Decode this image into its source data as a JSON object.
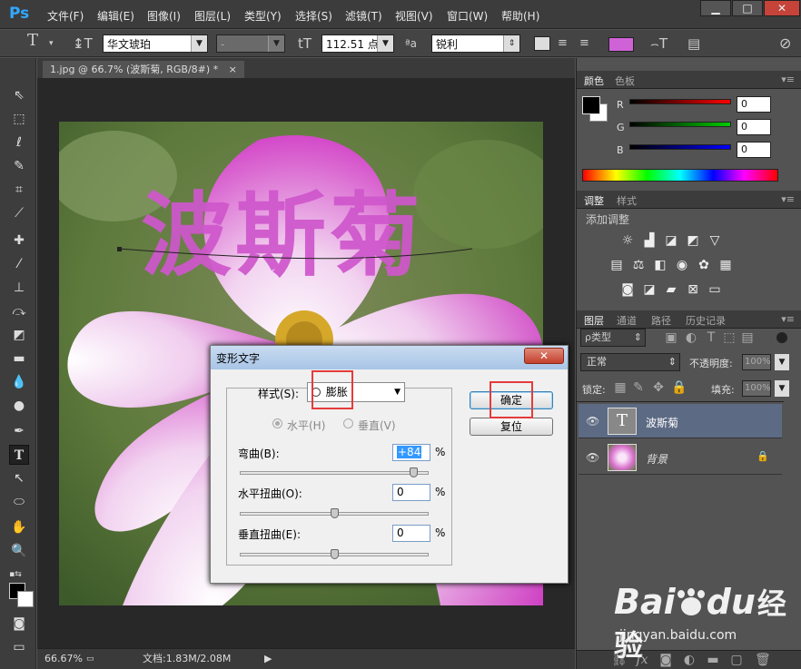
{
  "menubar": {
    "logo": "Ps",
    "items": [
      "文件(F)",
      "编辑(E)",
      "图像(I)",
      "图层(L)",
      "类型(Y)",
      "选择(S)",
      "滤镜(T)",
      "视图(V)",
      "窗口(W)",
      "帮助(H)"
    ]
  },
  "window_controls": {
    "minimize": "▁",
    "maximize": "□",
    "close": "✕"
  },
  "options_bar": {
    "font_family": "华文琥珀",
    "font_style": "-",
    "font_size": "112.51 点",
    "aa_label": "ªa",
    "antialias": "锐利",
    "text_color": "#d062d8"
  },
  "document": {
    "tab_title": "1.jpg @ 66.7% (波斯菊, RGB/8#) *",
    "tab_close": "×",
    "warped_text": "波斯菊",
    "text_color": "#cf57cc"
  },
  "statusbar": {
    "zoom": "66.67%",
    "doc_info": "文档:1.83M/2.08M"
  },
  "color_panel": {
    "tabs": [
      "颜色",
      "色板"
    ],
    "channels": [
      {
        "label": "R",
        "value": "0"
      },
      {
        "label": "G",
        "value": "0"
      },
      {
        "label": "B",
        "value": "0"
      }
    ]
  },
  "adjust_panel": {
    "tabs": [
      "调整",
      "样式"
    ],
    "title": "添加调整"
  },
  "layers_panel": {
    "tabs": [
      "图层",
      "通道",
      "路径",
      "历史记录"
    ],
    "filter_label": "ρ类型",
    "blend_mode": "正常",
    "opacity_label": "不透明度:",
    "opacity_value": "100%",
    "lock_label": "锁定:",
    "fill_label": "填充:",
    "fill_value": "100%",
    "layers": [
      {
        "name": "波斯菊",
        "thumb": "T",
        "selected": true
      },
      {
        "name": "背景",
        "thumb": "",
        "selected": false
      }
    ]
  },
  "dialog": {
    "title": "变形文字",
    "close": "✕",
    "style_label": "样式(S):",
    "style_value": "膨胀",
    "horizontal_label": "水平(H)",
    "vertical_label": "垂直(V)",
    "bend_label": "弯曲(B):",
    "bend_value": "+84",
    "bend_level": 84,
    "hdistort_label": "水平扭曲(O):",
    "hdistort_value": "0",
    "hdistort_level": 0,
    "vdistort_label": "垂直扭曲(E):",
    "vdistort_value": "0",
    "vdistort_level": 0,
    "percent": "%",
    "ok_label": "确定",
    "reset_label": "复位"
  },
  "watermark": {
    "brand": "Bai",
    "brand2": "du",
    "cn": "经验",
    "url": "jingyan.baidu.com"
  }
}
